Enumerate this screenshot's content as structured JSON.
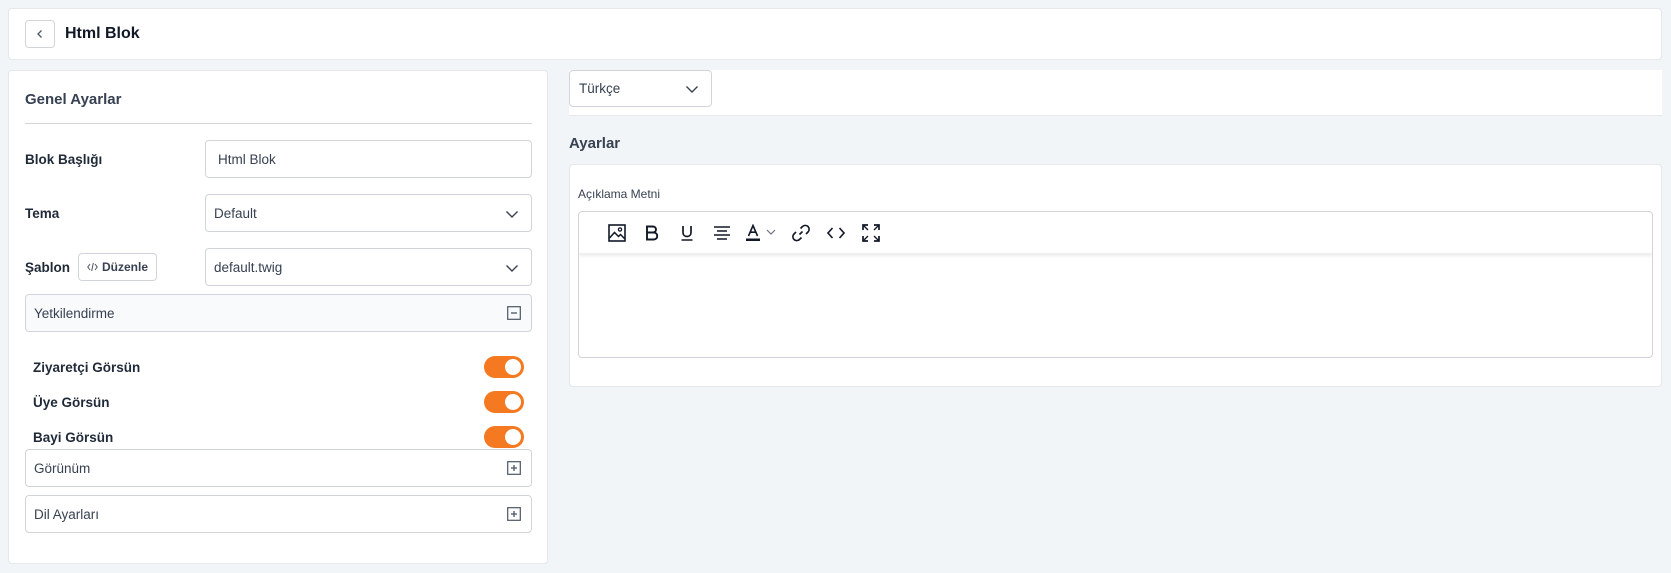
{
  "header": {
    "title": "Html Blok"
  },
  "general": {
    "title": "Genel Ayarlar",
    "block_title_label": "Blok Başlığı",
    "block_title_value": "Html Blok",
    "theme_label": "Tema",
    "theme_value": "Default",
    "template_label": "Şablon",
    "edit_label": "Düzenle",
    "template_value": "default.twig"
  },
  "authorization": {
    "title": "Yetkilendirme",
    "toggles": [
      {
        "label": "Ziyaretçi Görsün",
        "on": true
      },
      {
        "label": "Üye Görsün",
        "on": true
      },
      {
        "label": "Bayi Görsün",
        "on": true
      }
    ]
  },
  "appearance": {
    "title": "Görünüm"
  },
  "language_settings": {
    "title": "Dil Ayarları"
  },
  "language": {
    "selected": "Türkçe"
  },
  "settings": {
    "title": "Ayarlar",
    "description_label": "Açıklama Metni"
  },
  "colors": {
    "accent": "#f47920",
    "border": "#d1d5db",
    "background": "#f1f5f7"
  },
  "icons": {
    "back": "chevron-left-icon",
    "select": "chevron-down-icon",
    "collapse": "minus-square-icon",
    "expand": "plus-square-icon",
    "editor": [
      "image-icon",
      "bold-icon",
      "underline-icon",
      "align-center-icon",
      "text-color-icon",
      "link-icon",
      "code-icon",
      "fullscreen-icon"
    ]
  }
}
